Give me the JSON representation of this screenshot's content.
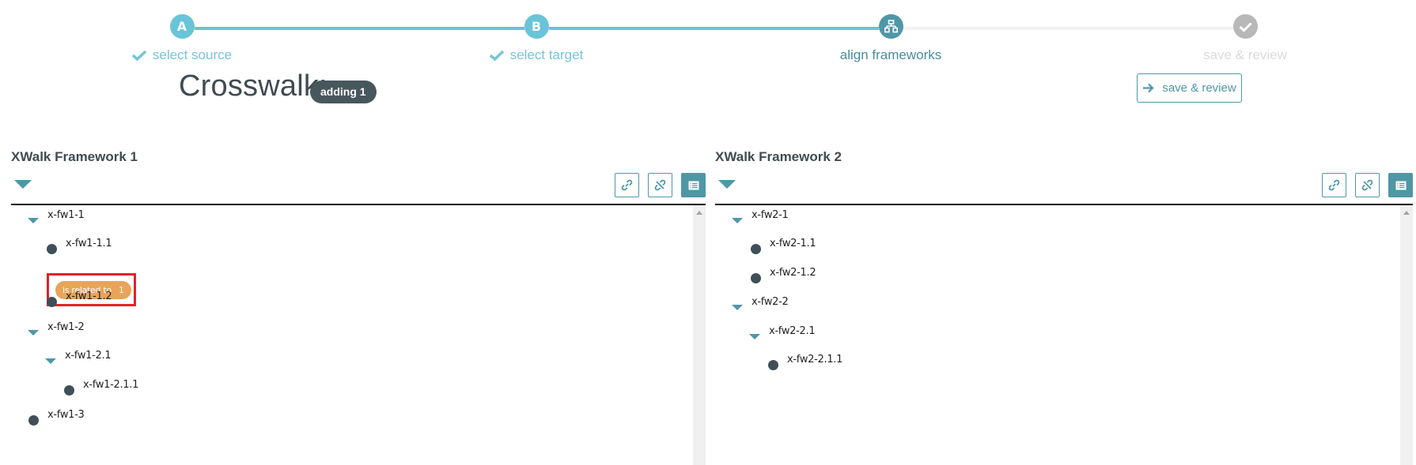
{
  "stepper": {
    "steps": [
      {
        "marker": "A",
        "label": "select source",
        "state": "done"
      },
      {
        "marker": "B",
        "label": "select target",
        "state": "done"
      },
      {
        "marker": "network-icon",
        "label": "align frameworks",
        "state": "active"
      },
      {
        "marker": "check-icon",
        "label": "save & review",
        "state": "todo"
      }
    ]
  },
  "header": {
    "title": "Crosswalk:",
    "badge": "adding 1",
    "save_review_button": "save & review"
  },
  "colors": {
    "accent": "#4f97a6",
    "step_done": "#68c4d8",
    "step_todo": "#b8b8b8",
    "badge_bg": "#48575d",
    "relation_pill": "#e8a459",
    "highlight_box": "#e5202a",
    "node_dot": "#404f57"
  },
  "panels": {
    "left": {
      "title": "XWalk Framework 1",
      "tools": [
        "link-icon",
        "unlink-icon",
        "list-icon"
      ],
      "nodes": [
        {
          "label": "x-fw1-1",
          "type": "branch",
          "depth": 0
        },
        {
          "label": "x-fw1-1.1",
          "type": "leaf",
          "depth": 1
        },
        {
          "label": "x-fw1-1.2",
          "type": "leaf",
          "depth": 1
        },
        {
          "label": "x-fw1-2",
          "type": "branch",
          "depth": 0
        },
        {
          "label": "x-fw1-2.1",
          "type": "branch",
          "depth": 1
        },
        {
          "label": "x-fw1-2.1.1",
          "type": "leaf",
          "depth": 2
        },
        {
          "label": "x-fw1-3",
          "type": "leaf",
          "depth": 0
        }
      ],
      "relation": {
        "label": "is related to",
        "count": "1",
        "under": "x-fw1-1.1"
      }
    },
    "right": {
      "title": "XWalk Framework 2",
      "tools": [
        "link-icon",
        "unlink-icon",
        "list-icon"
      ],
      "nodes": [
        {
          "label": "x-fw2-1",
          "type": "branch",
          "depth": 0
        },
        {
          "label": "x-fw2-1.1",
          "type": "leaf",
          "depth": 1
        },
        {
          "label": "x-fw2-1.2",
          "type": "leaf",
          "depth": 1
        },
        {
          "label": "x-fw2-2",
          "type": "branch",
          "depth": 0
        },
        {
          "label": "x-fw2-2.1",
          "type": "branch",
          "depth": 1
        },
        {
          "label": "x-fw2-2.1.1",
          "type": "leaf",
          "depth": 2
        }
      ]
    }
  }
}
